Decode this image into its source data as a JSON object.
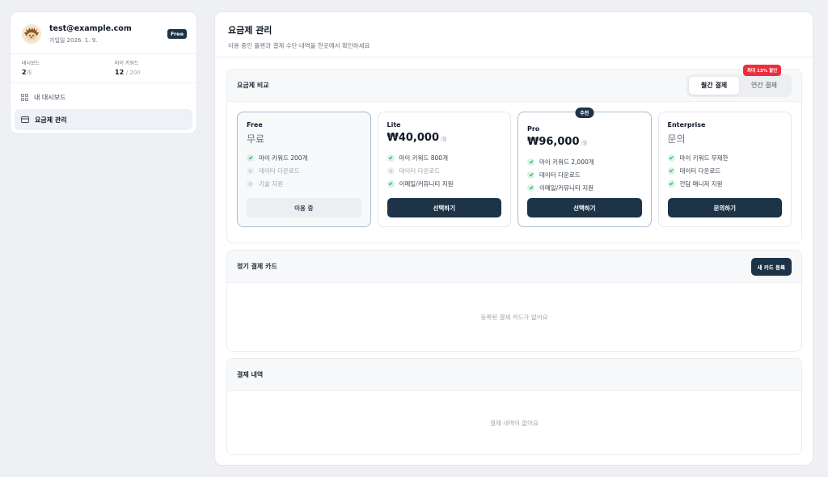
{
  "profile": {
    "email": "test@example.com",
    "joined": "가입일 2026. 1. 9.",
    "plan_badge": "Free"
  },
  "stats": {
    "dashboards_label": "대시보드",
    "dashboards_value": "2",
    "dashboards_unit": "개",
    "keywords_label": "마이 키워드",
    "keywords_value": "12",
    "keywords_total": "/ 200"
  },
  "nav": {
    "items": [
      {
        "label": "내 대시보드",
        "icon": "grid-icon"
      },
      {
        "label": "요금제 관리",
        "icon": "card-icon"
      }
    ]
  },
  "page": {
    "title": "요금제 관리",
    "subtitle": "이용 중인 플랜과 결제 수단·내역을 한곳에서 확인하세요"
  },
  "compare": {
    "title": "요금제 비교",
    "monthly_label": "월간 결제",
    "yearly_label": "연간 결제",
    "discount_badge": "최대 13% 할인"
  },
  "plans": [
    {
      "name": "Free",
      "price": "무료",
      "unit": "",
      "features": [
        {
          "text": "마이 키워드 200개",
          "on": true
        },
        {
          "text": "데이터 다운로드",
          "on": false
        },
        {
          "text": "기술 지원",
          "on": false
        }
      ],
      "button": "이용 중"
    },
    {
      "name": "Lite",
      "price": "₩40,000",
      "unit": "/월",
      "features": [
        {
          "text": "마이 키워드 800개",
          "on": true
        },
        {
          "text": "데이터 다운로드",
          "on": false
        },
        {
          "text": "이메일/커뮤니티 지원",
          "on": true
        }
      ],
      "button": "선택하기"
    },
    {
      "name": "Pro",
      "price": "₩96,000",
      "unit": "/월",
      "badge": "추천",
      "features": [
        {
          "text": "마이 키워드 2,000개",
          "on": true
        },
        {
          "text": "데이터 다운로드",
          "on": true
        },
        {
          "text": "이메일/커뮤니티 지원",
          "on": true
        }
      ],
      "button": "선택하기"
    },
    {
      "name": "Enterprise",
      "price": "문의",
      "unit": "",
      "features": [
        {
          "text": "마이 키워드 무제한",
          "on": true
        },
        {
          "text": "데이터 다운로드",
          "on": true
        },
        {
          "text": "전담 매니저 지원",
          "on": true
        }
      ],
      "button": "문의하기"
    }
  ],
  "billing_card": {
    "title": "정기 결제 카드",
    "add_button": "새 카드 등록",
    "empty": "등록된 결제 카드가 없어요"
  },
  "history": {
    "title": "결제 내역",
    "empty": "결제 내역이 없어요"
  },
  "colors": {
    "primary": "#1d3347",
    "discount": "#ef2d3b",
    "check": "#22a35a"
  }
}
